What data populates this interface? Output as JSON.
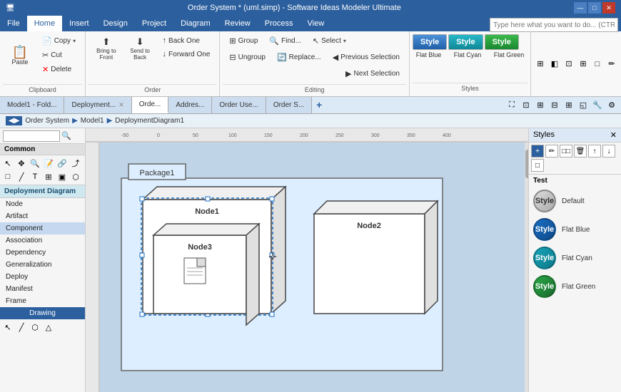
{
  "titleBar": {
    "title": "Order System * (uml.simp) - Software Ideas Modeler Ultimate",
    "minimize": "—",
    "maximize": "□",
    "close": "✕"
  },
  "menuBar": {
    "items": [
      "File",
      "Home",
      "Insert",
      "Design",
      "Project",
      "Diagram",
      "Review",
      "Process",
      "View"
    ]
  },
  "ribbon": {
    "searchPlaceholder": "Type here what you want to do... (CTRL+Q)",
    "groups": {
      "clipboard": {
        "label": "Clipboard",
        "paste": "Paste",
        "copy": "Copy",
        "cut": "Cut",
        "delete": "Delete"
      },
      "order": {
        "label": "Order",
        "bringToFront": "Bring to Front",
        "sendToBack": "Send to Back",
        "backOne": "Back One",
        "forwardOne": "Forward One"
      },
      "editing": {
        "label": "Editing",
        "group": "Group",
        "ungroup": "Ungroup",
        "find": "Find...",
        "replace": "Replace...",
        "select": "Select",
        "previousSelection": "Previous Selection",
        "nextSelection": "Next Selection"
      },
      "styles": {
        "label": "Styles",
        "style1": "Style",
        "style2": "Style",
        "style3": "Style",
        "flatBlue": "Flat Blue",
        "flatCyan": "Flat Cyan",
        "flatGreen": "Flat Green"
      }
    }
  },
  "tabs": [
    {
      "id": "model1",
      "label": "Model1 - Fold...",
      "active": false,
      "closable": false
    },
    {
      "id": "deployment",
      "label": "Deployment...",
      "active": false,
      "closable": true
    },
    {
      "id": "orde",
      "label": "Orde...",
      "active": true,
      "closable": false
    },
    {
      "id": "address",
      "label": "Addres...",
      "active": false,
      "closable": false
    },
    {
      "id": "orderuse",
      "label": "Order Use...",
      "active": false,
      "closable": false
    },
    {
      "id": "orders",
      "label": "Order S...",
      "active": false,
      "closable": false
    }
  ],
  "breadcrumb": {
    "items": [
      "Order System",
      "Model1",
      "DeploymentDiagram1"
    ]
  },
  "sidebar": {
    "searchPlaceholder": "",
    "sectionLabel": "Common",
    "diagramLabel": "Deployment Diagram",
    "items": [
      "Node",
      "Artifact",
      "Component",
      "Association",
      "Dependency",
      "Generalization",
      "Deploy",
      "Manifest",
      "Frame"
    ],
    "drawingLabel": "Drawing"
  },
  "canvas": {
    "packageLabel": "Package1",
    "node1Label": "Node1",
    "node2Label": "Node2",
    "node3Label": "Node3"
  },
  "stylesPanel": {
    "title": "Styles",
    "testLabel": "Test",
    "items": [
      {
        "id": "default",
        "styleClass": "default",
        "name": "Default"
      },
      {
        "id": "flat-blue",
        "styleClass": "flat-blue",
        "name": "Flat Blue"
      },
      {
        "id": "flat-cyan",
        "styleClass": "flat-cyan",
        "name": "Flat Cyan"
      },
      {
        "id": "flat-green",
        "styleClass": "flat-green",
        "name": "Flat Green"
      }
    ]
  }
}
